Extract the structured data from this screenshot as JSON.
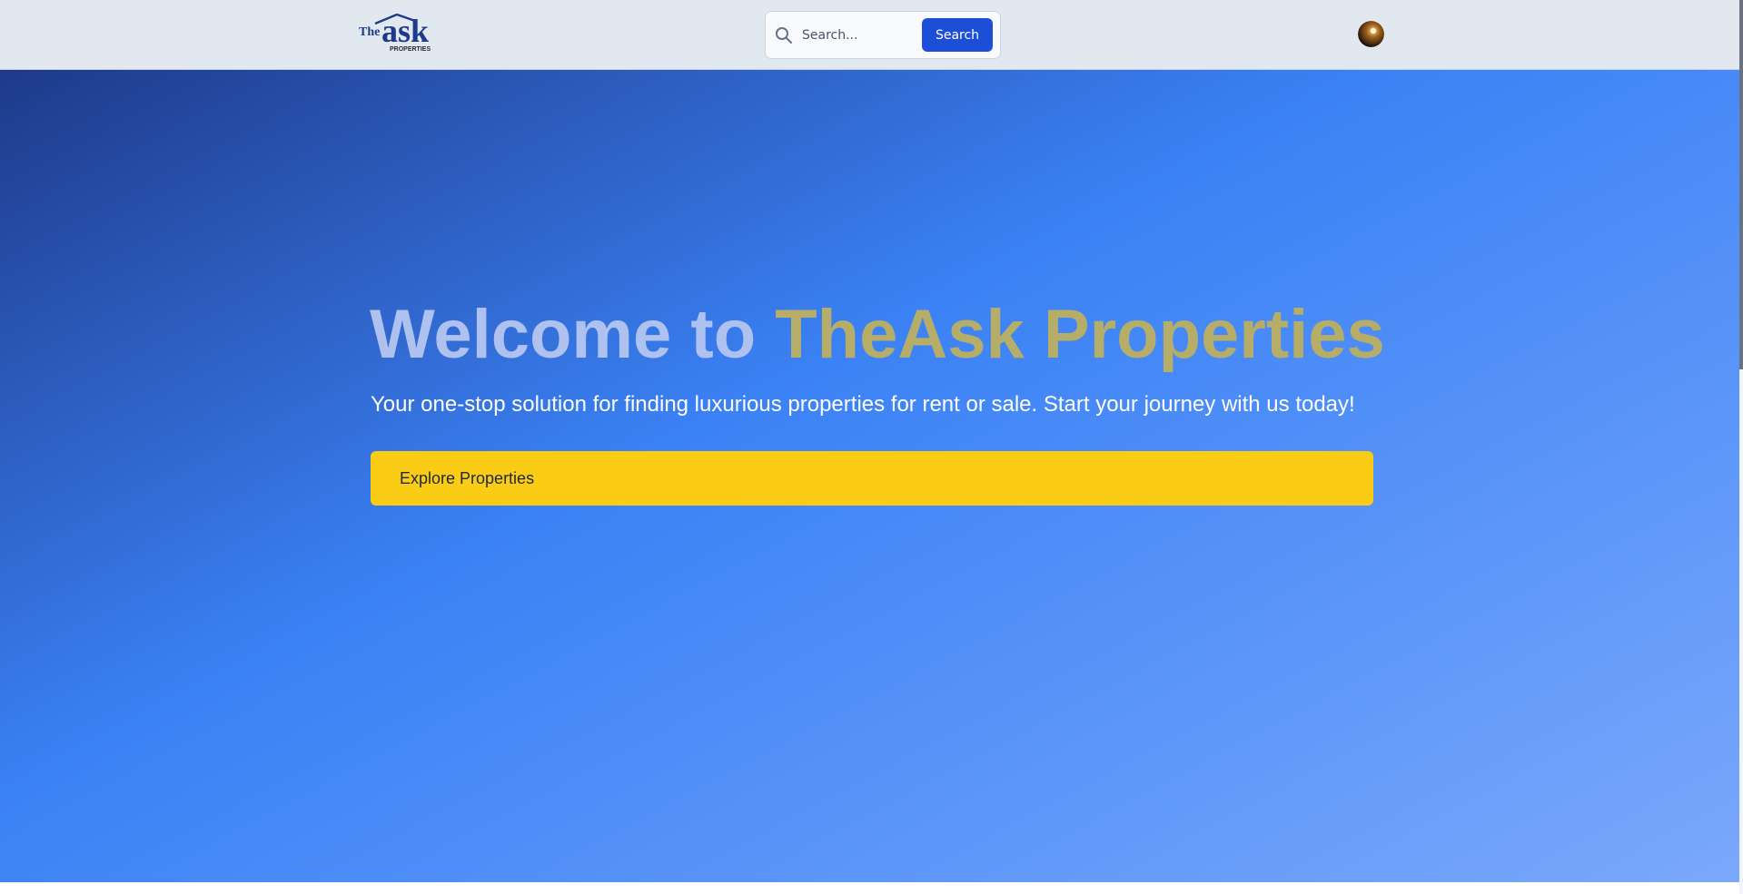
{
  "navbar": {
    "logo": {
      "text_small": "The",
      "text_large": "ask",
      "text_sub": "PROPERTIES"
    },
    "search": {
      "placeholder": "Search...",
      "value": "",
      "button_label": "Search"
    }
  },
  "hero": {
    "title_lead": "Welcome to ",
    "title_brand": "TheAsk Properties",
    "subtitle": "Your one-stop solution for finding luxurious properties for rent or sale. Start your journey with us today!",
    "cta_label": "Explore Properties"
  },
  "icons": {
    "search": "search-icon",
    "avatar": "user-avatar"
  },
  "colors": {
    "navbar_bg": "#e2e8f0",
    "hero_gradient_start": "#1e3a8a",
    "hero_gradient_mid": "#3b82f6",
    "hero_gradient_end": "#7aa8fb",
    "title_lead": "#afc2ef",
    "title_brand": "#b6ad68",
    "cta_bg": "#facc15",
    "search_button_bg": "#1d4ed8"
  }
}
